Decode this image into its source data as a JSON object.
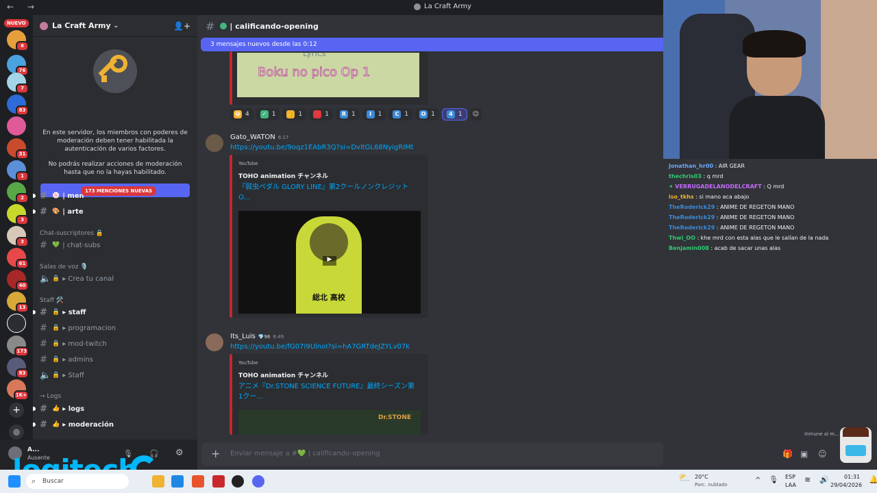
{
  "titlebar": {
    "title": "La Craft Army",
    "nav": "← →"
  },
  "rail": {
    "nuevo": "NUEVO",
    "badges": [
      "6",
      "76",
      "7",
      "83",
      "31",
      "1",
      "2",
      "3",
      "3",
      "61",
      "40",
      "13",
      "173",
      "83",
      "1K+"
    ],
    "colors": {
      "danger": "#da373c",
      "blurple": "#5865f2",
      "link": "#00a8fc"
    }
  },
  "server": {
    "name": "La Craft Army",
    "mod_text_1": "En este servidor, los miembros con poderes de moderación deben tener habilitada la autenticación de varios factores.",
    "mod_text_2": "No podrás realizar acciones de moderación hasta que no la hayas habilitado.",
    "solucionar": "Solucionar"
  },
  "channels": {
    "mentions_badge": "173 MENCIONES NUEVAS",
    "items": [
      {
        "name": "| men",
        "emoji": "🍥",
        "bold": true
      },
      {
        "name": "| arte",
        "emoji": "🎨",
        "bold": true
      },
      {
        "name": "| chat-subs",
        "emoji": "💚",
        "bold": false
      },
      {
        "name": "▸ Crea tu canal",
        "emoji": "🔒",
        "bold": false
      },
      {
        "name": "▸ staff",
        "emoji": "🔒",
        "bold": true
      },
      {
        "name": "▸ programacion",
        "emoji": "🔒",
        "bold": false
      },
      {
        "name": "▸ mod-twitch",
        "emoji": "🔒",
        "bold": false
      },
      {
        "name": "▸ admins",
        "emoji": "🔒",
        "bold": false
      },
      {
        "name": "▸ Staff",
        "emoji": "🔒",
        "bold": false
      },
      {
        "name": "▸ logs",
        "emoji": "👍",
        "bold": true
      },
      {
        "name": "▸ moderación",
        "emoji": "👍",
        "bold": true
      }
    ],
    "categories": [
      "Chat-suscriptores 🔒",
      "Salas de voz 🎙️",
      "Staff 🛠️",
      "→ Logs"
    ]
  },
  "user": {
    "name": "A...",
    "status": "Ausente"
  },
  "logitech": "logitech",
  "chat": {
    "channel": "| calificando-opening",
    "new_messages": "3 mensajes nuevos desde las 0:12",
    "first_thumb_text": "Boku no pico Op 1",
    "first_thumb_top": "Lyrics",
    "reactions": [
      {
        "emoji": "🤣",
        "count": "4",
        "color": "#f0b232"
      },
      {
        "emoji": "✅",
        "count": "1",
        "color": "#43b581"
      },
      {
        "emoji": "👍",
        "count": "1",
        "color": "#f0b232"
      },
      {
        "emoji": "💯",
        "count": "1",
        "color": "#da373c"
      },
      {
        "emoji": "R",
        "count": "1",
        "color": "#3c8ad9"
      },
      {
        "emoji": "I",
        "count": "1",
        "color": "#3c8ad9"
      },
      {
        "emoji": "C",
        "count": "1",
        "color": "#3c8ad9"
      },
      {
        "emoji": "O",
        "count": "1",
        "color": "#3c8ad9"
      },
      {
        "emoji": "4",
        "count": "1",
        "color": "#3c8ad9",
        "active": true
      }
    ],
    "messages": [
      {
        "author": "Gato_WATON",
        "time": "6:17",
        "link": "https://youtu.be/9oqz1EAbR3Q?si=DvltGL68NyigRIMt",
        "provider": "YouTube",
        "channel": "TOHO animation チャンネル",
        "title": "『弱虫ペダル GLORY LINE』第2クールノンクレジットO...",
        "thumb_text": "総北 高校"
      },
      {
        "author": "Its_Luis",
        "badge": "96",
        "time": "6:49",
        "link": "https://youtu.be/fG07I9UlnoI?si=hA7GRTdeJZYLv07k",
        "provider": "YouTube",
        "channel": "TOHO animation チャンネル",
        "title": "アニメ『Dr.STONE SCIENCE FUTURE』最終シーズン第1クー...",
        "thumb_text": "Dr.STONE"
      }
    ],
    "composer_placeholder": "Enviar mensaje a #💚 | calificando-opening"
  },
  "stream_chat": {
    "lines": [
      {
        "user": "Jonathan_hr00",
        "color": "#6aa8ff",
        "text": ": AIR GEAR"
      },
      {
        "user": "thechris03",
        "color": "#2ecc71",
        "text": ": q mrd"
      },
      {
        "user": "VERRUGADELANODELCRAFT",
        "color": "#c56bff",
        "text": ": Q mrd"
      },
      {
        "user": "iso_tkhs",
        "color": "#f0b232",
        "text": ": si mano aca abajo"
      },
      {
        "user": "TheRoderick29",
        "color": "#3c8ad9",
        "text": ": ANIME DE REGETON MANO"
      },
      {
        "user": "TheRoderick29",
        "color": "#3c8ad9",
        "text": ": ANIME DE REGETON MANO"
      },
      {
        "user": "TheRoderick29",
        "color": "#3c8ad9",
        "text": ": ANIME DE REGETON MANO"
      },
      {
        "user": "Thwi_OO",
        "color": "#2ecc71",
        "text": ": khe mrd con esta alas que le salían de la nada"
      },
      {
        "user": "Benjamin008",
        "color": "#2ecc71",
        "text": ": acab de sacar unas alas"
      }
    ],
    "immune": "Inmune al m..."
  },
  "taskbar": {
    "search": "Buscar",
    "weather_temp": "20°C",
    "weather_desc": "Parc. nublado",
    "lang1": "ESP",
    "lang2": "LAA",
    "time": "01:31",
    "date": "29/04/2026"
  }
}
